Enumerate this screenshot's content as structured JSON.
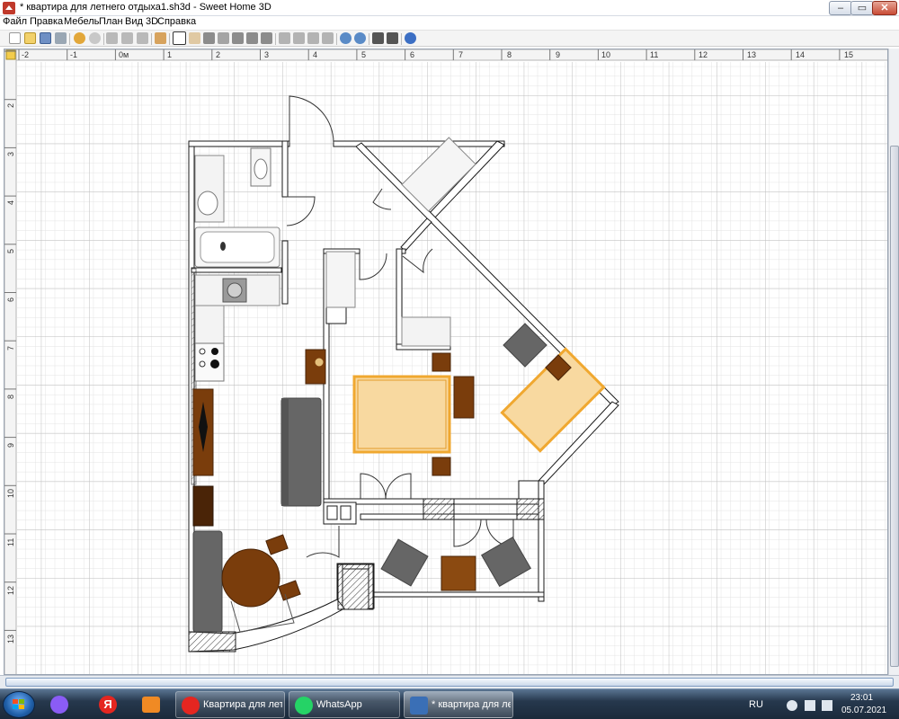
{
  "window": {
    "title": "* квартира для летнего отдыха1.sh3d - Sweet Home 3D",
    "minimize": "–",
    "maximize": "▭",
    "close": "✕"
  },
  "menu": [
    "Файл",
    "Правка",
    "Мебель",
    "План",
    "Вид 3D",
    "Справка"
  ],
  "toolbar_icons": [
    "new-icon",
    "open-icon",
    "save-icon",
    "cut-icon",
    "undo-icon",
    "redo-icon",
    "cut-icon",
    "copy-icon",
    "paste-icon",
    "add-furniture-icon",
    "select-icon",
    "pan-icon",
    "create-walls-icon",
    "create-rooms-icon",
    "create-polylines-icon",
    "create-dimensions-icon",
    "add-text-icon",
    "text-style-icon",
    "text-style-icon",
    "text-style-icon",
    "text-style-icon",
    "zoom-in-icon",
    "zoom-out-icon",
    "create-photo-icon",
    "create-video-icon",
    "help-icon"
  ],
  "ruler": {
    "h_labels": [
      "-2",
      "-1",
      "0м",
      "1",
      "2",
      "3",
      "4",
      "5",
      "6",
      "7",
      "8",
      "9",
      "10",
      "11",
      "12",
      "13",
      "14",
      "15"
    ],
    "v_labels": [
      "2",
      "3",
      "4",
      "5",
      "6",
      "7",
      "8",
      "9",
      "10",
      "11",
      "12",
      "13"
    ]
  },
  "taskbar": {
    "tasks": [
      {
        "label": "Квартира для летнего...",
        "icon_color": "#e52620",
        "active": false
      },
      {
        "label": "WhatsApp",
        "icon_color": "#25d366",
        "active": false
      },
      {
        "label": "* квартира для ле...",
        "icon_color": "#3a6fb6",
        "active": true
      }
    ],
    "lang": "RU",
    "time": "23:01",
    "date": "05.07.2021"
  },
  "colors": {
    "wall": "#1a1a1a",
    "grid_minor": "#e3e3e3",
    "grid_major": "#bfbfbf",
    "wood_dark": "#7a3d0c",
    "bed_fill": "#f8d9a0",
    "bed_outline": "#f0a830",
    "sofa": "#666666"
  }
}
